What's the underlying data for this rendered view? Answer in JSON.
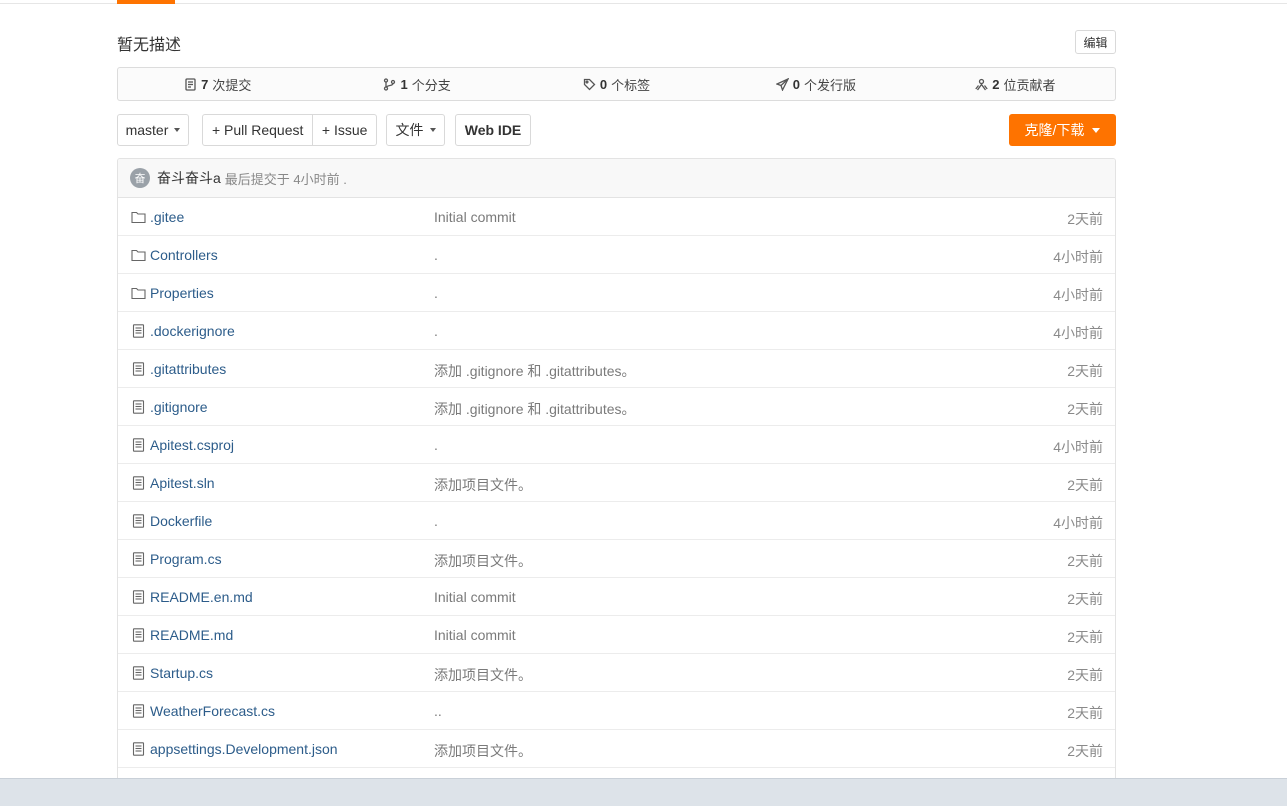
{
  "repo": {
    "description": "暂无描述",
    "edit_label": "编辑"
  },
  "stats": [
    {
      "icon": "commit-icon",
      "count": "7",
      "label": "次提交"
    },
    {
      "icon": "branch-icon",
      "count": "1",
      "label": "个分支"
    },
    {
      "icon": "tag-icon",
      "count": "0",
      "label": "个标签"
    },
    {
      "icon": "release-icon",
      "count": "0",
      "label": "个发行版"
    },
    {
      "icon": "contributors-icon",
      "count": "2",
      "label": "位贡献者"
    }
  ],
  "toolbar": {
    "branch": "master",
    "pull_request": "+ Pull Request",
    "issue": "+ Issue",
    "file_menu": "文件",
    "web_ide": "Web IDE",
    "clone": "克隆/下载"
  },
  "last_commit": {
    "avatar_letter": "奋",
    "author": "奋斗奋斗a",
    "text": "最后提交于 4小时前 ."
  },
  "files": [
    {
      "type": "folder",
      "name": ".gitee",
      "message": "Initial commit",
      "time": "2天前"
    },
    {
      "type": "folder",
      "name": "Controllers",
      "message": ".",
      "time": "4小时前"
    },
    {
      "type": "folder",
      "name": "Properties",
      "message": ".",
      "time": "4小时前"
    },
    {
      "type": "file",
      "name": ".dockerignore",
      "message": ".",
      "time": "4小时前"
    },
    {
      "type": "file",
      "name": ".gitattributes",
      "message": "添加 .gitignore 和 .gitattributes。",
      "time": "2天前"
    },
    {
      "type": "file",
      "name": ".gitignore",
      "message": "添加 .gitignore 和 .gitattributes。",
      "time": "2天前"
    },
    {
      "type": "file",
      "name": "Apitest.csproj",
      "message": ".",
      "time": "4小时前"
    },
    {
      "type": "file",
      "name": "Apitest.sln",
      "message": "添加项目文件。",
      "time": "2天前"
    },
    {
      "type": "file",
      "name": "Dockerfile",
      "message": ".",
      "time": "4小时前"
    },
    {
      "type": "file",
      "name": "Program.cs",
      "message": "添加项目文件。",
      "time": "2天前"
    },
    {
      "type": "file",
      "name": "README.en.md",
      "message": "Initial commit",
      "time": "2天前"
    },
    {
      "type": "file",
      "name": "README.md",
      "message": "Initial commit",
      "time": "2天前"
    },
    {
      "type": "file",
      "name": "Startup.cs",
      "message": "添加项目文件。",
      "time": "2天前"
    },
    {
      "type": "file",
      "name": "WeatherForecast.cs",
      "message": "..",
      "time": "2天前"
    },
    {
      "type": "file",
      "name": "appsettings.Development.json",
      "message": "添加项目文件。",
      "time": "2天前"
    }
  ],
  "colors": {
    "accent": "#fe7300",
    "link": "#2c5c8a"
  }
}
